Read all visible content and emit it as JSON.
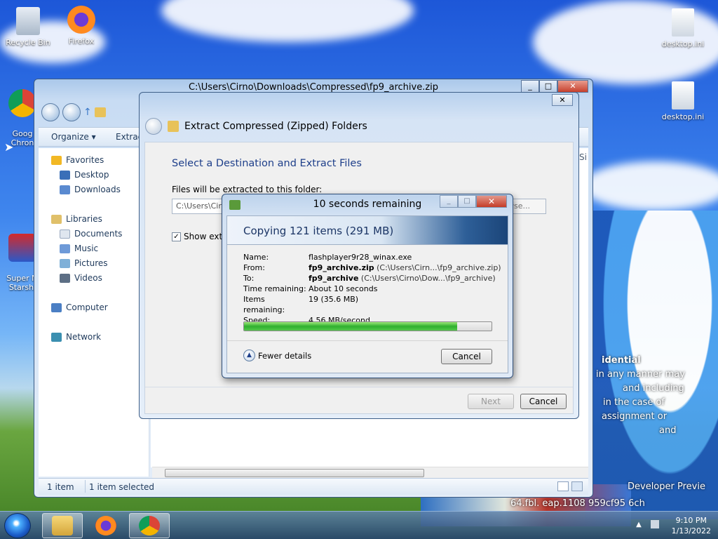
{
  "desktop": {
    "icons": [
      {
        "label": "Recycle Bin"
      },
      {
        "label": "Firefox"
      },
      {
        "label": "Goog\nChron"
      },
      {
        "label": "Super M\nStarshi"
      },
      {
        "label": "desktop.ini"
      },
      {
        "label": "desktop.ini"
      }
    ],
    "watermark_lines": [
      "idential",
      "in any manner may",
      "and including",
      "in the case of",
      "assignment or",
      "and",
      "Developer Previe",
      "64.fbl.       eap.1108        959cf95      6ch"
    ]
  },
  "explorer": {
    "title": "C:\\Users\\Cirno\\Downloads\\Compressed\\fp9_archive.zip",
    "toolbar": {
      "organize": "Organize ▾",
      "extract": "Extract"
    },
    "nav": {
      "favorites": "Favorites",
      "desktop": "Desktop",
      "downloads": "Downloads",
      "libraries": "Libraries",
      "documents": "Documents",
      "music": "Music",
      "pictures": "Pictures",
      "videos": "Videos",
      "computer": "Computer",
      "network": "Network"
    },
    "column_header_partial": "Si",
    "status": {
      "items": "1 item",
      "selected": "1 item selected"
    }
  },
  "extract_dialog": {
    "title": "Extract Compressed (Zipped) Folders",
    "heading": "Select a Destination and Extract Files",
    "folder_label": "Files will be extracted to this folder:",
    "path_value": "C:\\Users\\Cirno",
    "browse_label": "wse...",
    "show_checkbox_label": "Show extra",
    "show_checked": true,
    "next_label": "Next",
    "cancel_label": "Cancel"
  },
  "copy_dialog": {
    "title": "10 seconds remaining",
    "heading": "Copying 121 items (291 MB)",
    "details": {
      "name_key": "Name:",
      "name_val": "flashplayer9r28_winax.exe",
      "from_key": "From:",
      "from_bold": "fp9_archive.zip",
      "from_path": "(C:\\Users\\Cirn...\\fp9_archive.zip)",
      "to_key": "To:",
      "to_bold": "fp9_archive",
      "to_path": "(C:\\Users\\Cirno\\Dow...\\fp9_archive)",
      "time_key": "Time remaining:",
      "time_val": "About 10 seconds",
      "items_key": "Items remaining:",
      "items_val": "19 (35.6 MB)",
      "speed_key": "Speed:",
      "speed_val": "4.56 MB/second"
    },
    "progress_fraction": 0.86,
    "fewer_details_label": "Fewer details",
    "cancel_label": "Cancel"
  },
  "taskbar": {
    "clock_time": "9:10 PM",
    "clock_date": "1/13/2022"
  },
  "colors": {
    "progress_green": "#2fb02f",
    "heading_blue": "#1e3f8a"
  }
}
